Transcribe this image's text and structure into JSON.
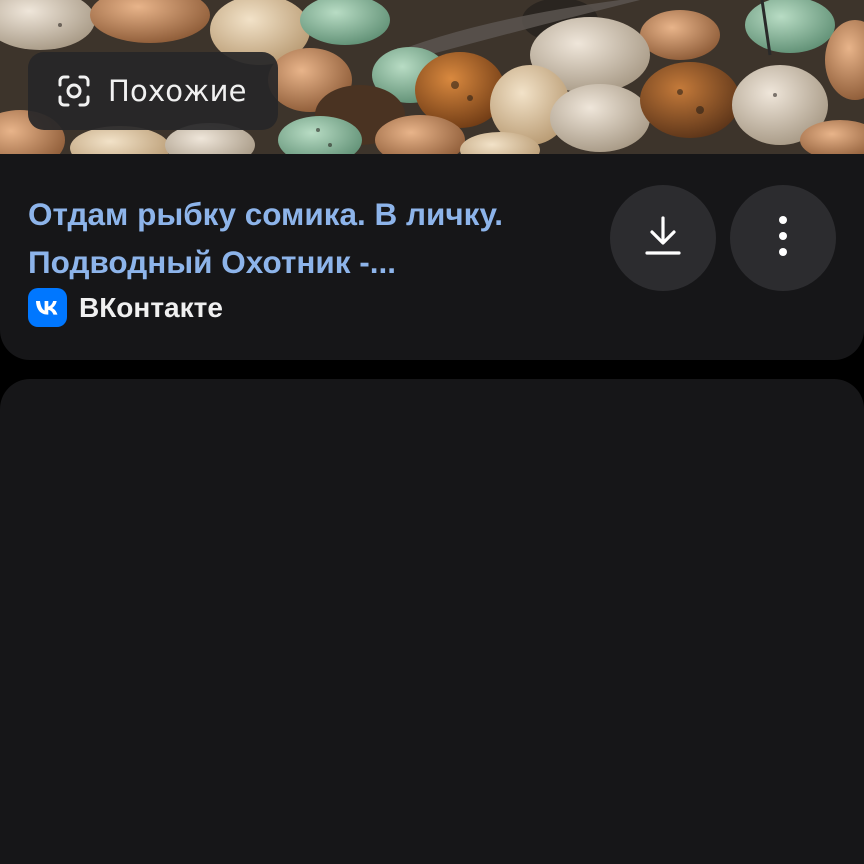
{
  "preview": {
    "image_description_icon": "aquarium-gravel-photo",
    "similar_button": {
      "icon": "camera-lens-icon",
      "label": "Похожие"
    }
  },
  "result": {
    "title_line1": "Отдам рыбку сомика. В личку.",
    "title_line2": "Подводный Охотник -...",
    "source": {
      "icon": "vk-logo-icon",
      "name": "ВКонтакте"
    },
    "actions": {
      "download_icon": "download-icon",
      "more_icon": "more-vertical-icon"
    }
  },
  "colors": {
    "background": "#000000",
    "card": "#161618",
    "title_link": "#8db4ea",
    "button_bg": "#2c2c2f",
    "vk_blue": "#0077ff"
  }
}
